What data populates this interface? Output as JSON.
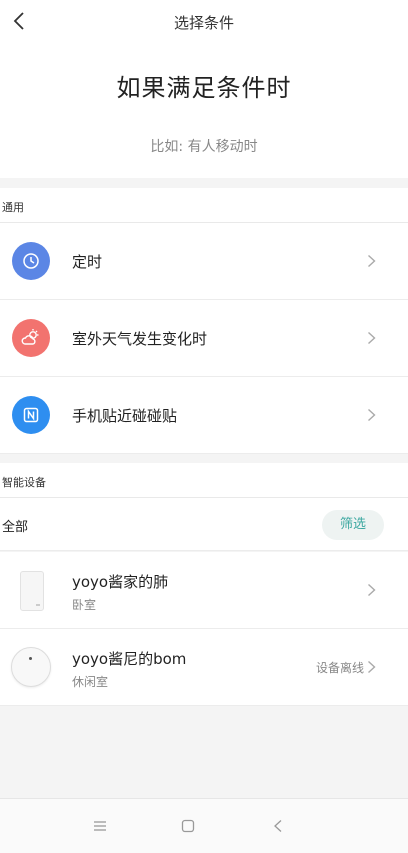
{
  "header": {
    "title": "选择条件"
  },
  "hero": {
    "title": "如果满足条件时",
    "subtitle": "比如: 有人移动时"
  },
  "general": {
    "section_label": "通用",
    "items": [
      {
        "label": "定时",
        "icon": "clock-icon",
        "color": "#5b86e5"
      },
      {
        "label": "室外天气发生变化时",
        "icon": "weather-icon",
        "color": "#f2736f"
      },
      {
        "label": "手机贴近碰碰贴",
        "icon": "nfc-icon",
        "color": "#2e8ef0"
      }
    ]
  },
  "smart_devices": {
    "section_label": "智能设备",
    "all_label": "全部",
    "filter_label": "筛选",
    "devices": [
      {
        "name": "yoyo酱家的肺",
        "room": "卧室",
        "status": ""
      },
      {
        "name": "yoyo酱尼的bom",
        "room": "休闲室",
        "status": "设备离线"
      }
    ]
  }
}
